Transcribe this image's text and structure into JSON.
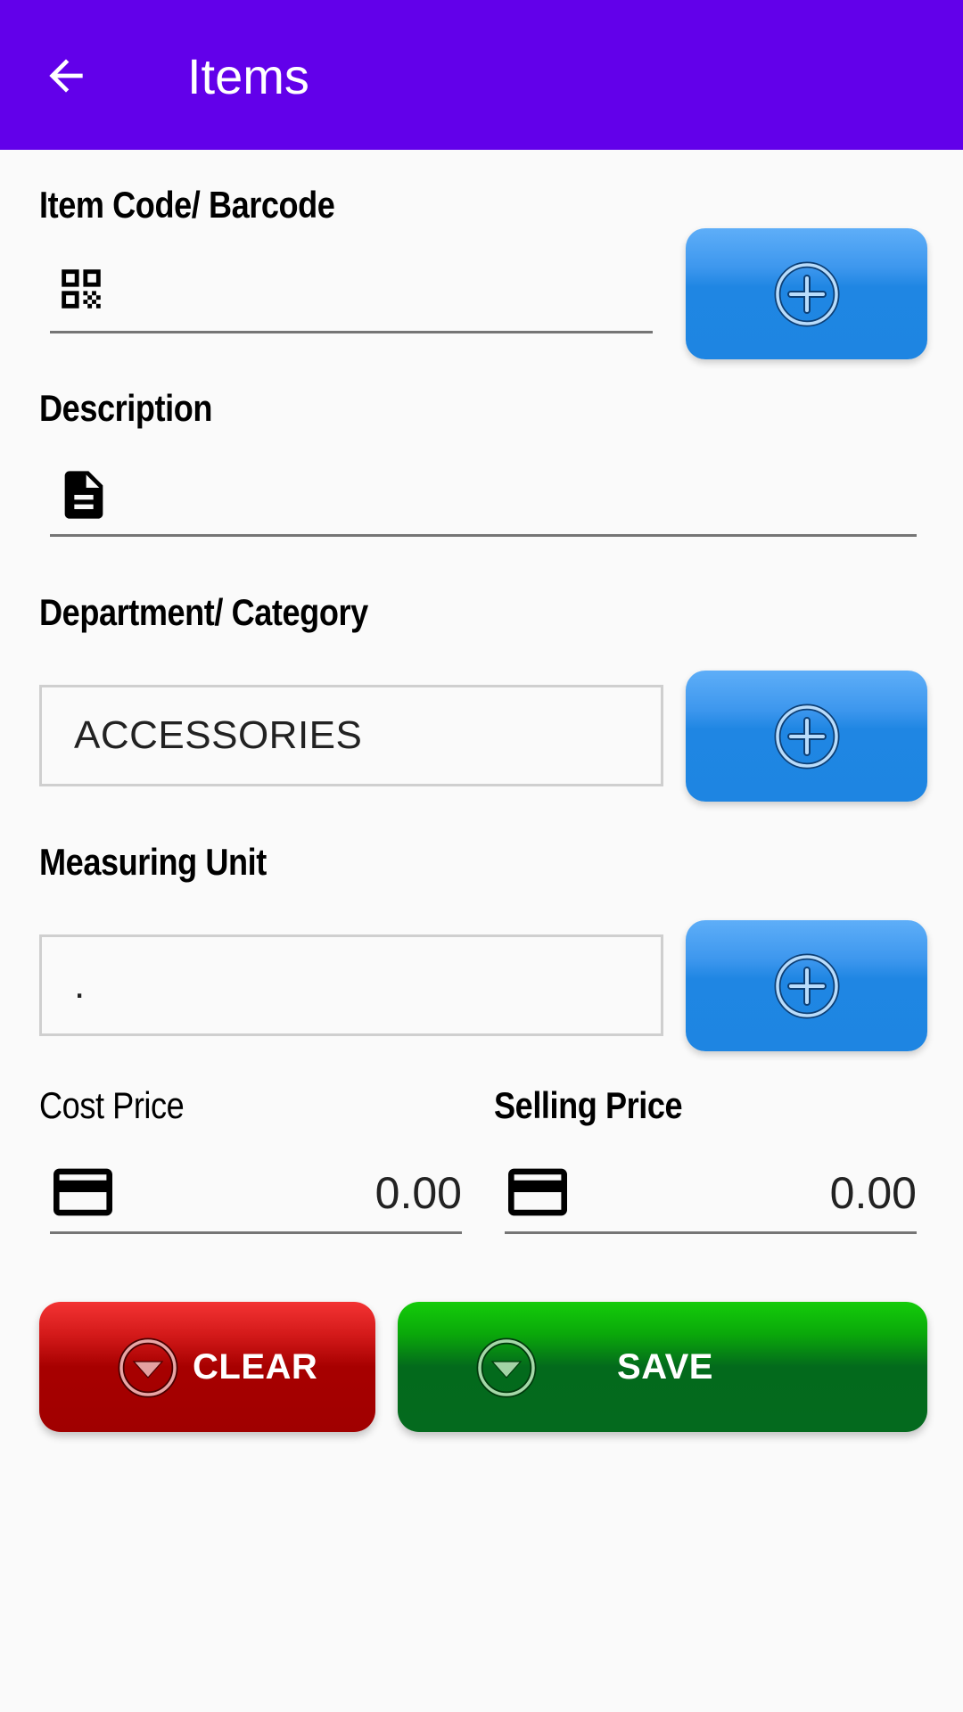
{
  "appbar": {
    "title": "Items",
    "back_icon": "arrow-left-icon",
    "color": "#6200ea"
  },
  "form": {
    "item_code": {
      "label": "Item Code/ Barcode",
      "icon": "qr-code-icon",
      "value": "",
      "placeholder": "",
      "add_icon": "plus-circle-icon"
    },
    "description": {
      "label": "Description",
      "icon": "document-icon",
      "value": "",
      "placeholder": ""
    },
    "category": {
      "label": "Department/ Category",
      "value": "ACCESSORIES",
      "add_icon": "plus-circle-icon"
    },
    "measuring_unit": {
      "label": "Measuring Unit",
      "value": ".",
      "add_icon": "plus-circle-icon"
    },
    "cost_price": {
      "label": "Cost Price",
      "icon": "credit-card-icon",
      "value": "0.00"
    },
    "selling_price": {
      "label": "Selling Price",
      "icon": "credit-card-icon",
      "value": "0.00"
    }
  },
  "actions": {
    "clear": {
      "label": "CLEAR",
      "icon": "chevron-down-circle-icon",
      "color": "#a70000"
    },
    "save": {
      "label": "SAVE",
      "icon": "chevron-down-circle-icon",
      "color": "#036a1c"
    }
  },
  "colors": {
    "add_button": "#1f86e3",
    "background": "#fafafa"
  }
}
